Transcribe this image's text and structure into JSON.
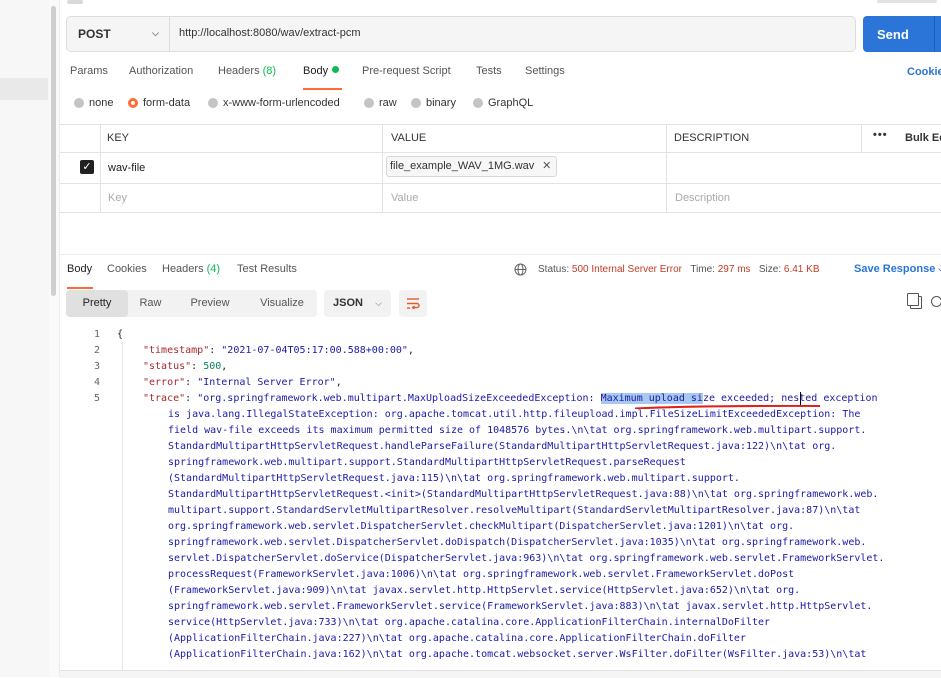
{
  "request": {
    "method": "POST",
    "url": "http://localhost:8080/wav/extract-pcm",
    "send_label": "Send"
  },
  "request_tabs": {
    "params": "Params",
    "authorization": "Authorization",
    "headers": "Headers",
    "headers_count": "(8)",
    "body": "Body",
    "pre_request": "Pre-request Script",
    "tests": "Tests",
    "settings": "Settings",
    "cookies": "Cookie"
  },
  "body_types": {
    "none": "none",
    "form_data": "form-data",
    "urlencoded": "x-www-form-urlencoded",
    "raw": "raw",
    "binary": "binary",
    "graphql": "GraphQL",
    "selected": "form-data"
  },
  "form_table": {
    "headers": {
      "key": "KEY",
      "value": "VALUE",
      "description": "DESCRIPTION",
      "bulk_edit": "Bulk Ed"
    },
    "rows": [
      {
        "checked": true,
        "key": "wav-file",
        "value": "file_example_WAV_1MG.wav",
        "description": ""
      }
    ],
    "placeholder": {
      "key": "Key",
      "value": "Value",
      "description": "Description"
    }
  },
  "response": {
    "tabs": {
      "body": "Body",
      "cookies": "Cookies",
      "headers": "Headers",
      "headers_count": "(4)",
      "test_results": "Test Results"
    },
    "status_label": "Status:",
    "status_value": "500 Internal Server Error",
    "time_label": "Time:",
    "time_value": "297 ms",
    "size_label": "Size:",
    "size_value": "6.41 KB",
    "save_label": "Save Response"
  },
  "view_modes": {
    "pretty": "Pretty",
    "raw": "Raw",
    "preview": "Preview",
    "visualize": "Visualize",
    "format": "JSON"
  },
  "code": {
    "line_numbers": [
      "1",
      "2",
      "3",
      "4",
      "5"
    ],
    "open_brace": "{",
    "timestamp_key": "\"timestamp\"",
    "timestamp_val": "\"2021-07-04T05:17:00.588+00:00\"",
    "status_key": "\"status\"",
    "status_val": "500",
    "error_key": "\"error\"",
    "error_val": "\"Internal Server Error\"",
    "trace_key": "\"trace\"",
    "trace_pre": "\"org.springframework.web.multipart.MaxUploadSizeExceededException: ",
    "trace_highlight": "Maximum upload si",
    "trace_post": "ze exceeded; nested exception",
    "wrapped_lines": [
      "is java.lang.IllegalStateException: org.apache.tomcat.util.http.fileupload.impl.FileSizeLimitExceededException: The",
      "field wav-file exceeds its maximum permitted size of 1048576 bytes.\\n\\tat org.springframework.web.multipart.support.",
      "StandardMultipartHttpServletRequest.handleParseFailure(StandardMultipartHttpServletRequest.java:122)\\n\\tat org.",
      "springframework.web.multipart.support.StandardMultipartHttpServletRequest.parseRequest",
      "(StandardMultipartHttpServletRequest.java:115)\\n\\tat org.springframework.web.multipart.support.",
      "StandardMultipartHttpServletRequest.<init>(StandardMultipartHttpServletRequest.java:88)\\n\\tat org.springframework.web.",
      "multipart.support.StandardServletMultipartResolver.resolveMultipart(StandardServletMultipartResolver.java:87)\\n\\tat",
      "org.springframework.web.servlet.DispatcherServlet.checkMultipart(DispatcherServlet.java:1201)\\n\\tat org.",
      "springframework.web.servlet.DispatcherServlet.doDispatch(DispatcherServlet.java:1035)\\n\\tat org.springframework.web.",
      "servlet.DispatcherServlet.doService(DispatcherServlet.java:963)\\n\\tat org.springframework.web.servlet.FrameworkServlet.",
      "processRequest(FrameworkServlet.java:1006)\\n\\tat org.springframework.web.servlet.FrameworkServlet.doPost",
      "(FrameworkServlet.java:909)\\n\\tat javax.servlet.http.HttpServlet.service(HttpServlet.java:652)\\n\\tat org.",
      "springframework.web.servlet.FrameworkServlet.service(FrameworkServlet.java:883)\\n\\tat javax.servlet.http.HttpServlet.",
      "service(HttpServlet.java:733)\\n\\tat org.apache.catalina.core.ApplicationFilterChain.internalDoFilter",
      "(ApplicationFilterChain.java:227)\\n\\tat org.apache.catalina.core.ApplicationFilterChain.doFilter",
      "(ApplicationFilterChain.java:162)\\n\\tat org.apache.tomcat.websocket.server.WsFilter.doFilter(WsFilter.java:53)\\n\\tat"
    ]
  },
  "colors": {
    "accent": "#ff6c37",
    "send_blue": "#2a75d7",
    "status_error": "#c23b22",
    "highlight": "#a8c8f0",
    "annotation_red": "#e0201b"
  }
}
